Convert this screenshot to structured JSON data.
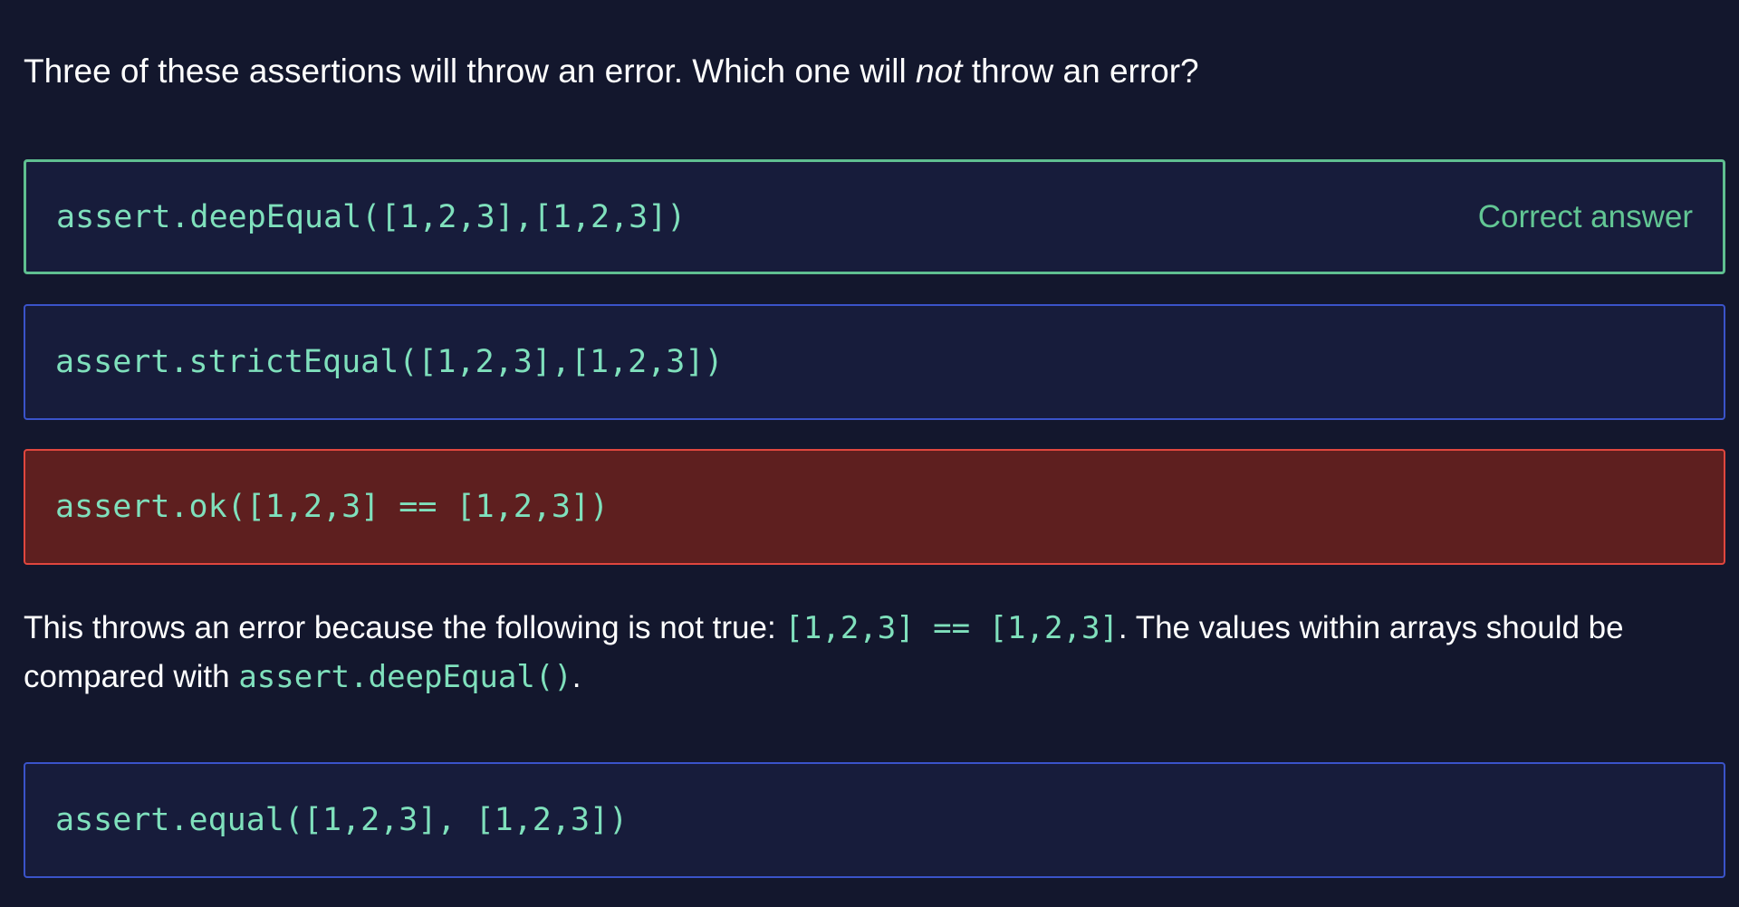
{
  "question": {
    "before": "Three of these assertions will throw an error. Which one will ",
    "emphasis": "not",
    "after": " throw an error?"
  },
  "options": [
    {
      "code": "assert.deepEqual([1,2,3],[1,2,3])",
      "status": "correct",
      "badge": "Correct answer"
    },
    {
      "code": "assert.strictEqual([1,2,3],[1,2,3])",
      "status": "neutral"
    },
    {
      "code": "assert.ok([1,2,3] == [1,2,3])",
      "status": "selected-wrong"
    },
    {
      "code": "assert.equal([1,2,3], [1,2,3])",
      "status": "neutral"
    }
  ],
  "explanation": {
    "part1": "This throws an error because the following is not true: ",
    "code1": "[1,2,3] == [1,2,3]",
    "part2": ". The values within arrays should be compared with ",
    "code2": "assert.deepEqual()",
    "part3": "."
  },
  "colors": {
    "background": "#13172d",
    "option_background": "#171c3b",
    "option_border": "#3a53c9",
    "correct_border": "#5fbf90",
    "wrong_background": "#5e1f1f",
    "wrong_border": "#e0463e",
    "code_text": "#7fe0bc"
  }
}
